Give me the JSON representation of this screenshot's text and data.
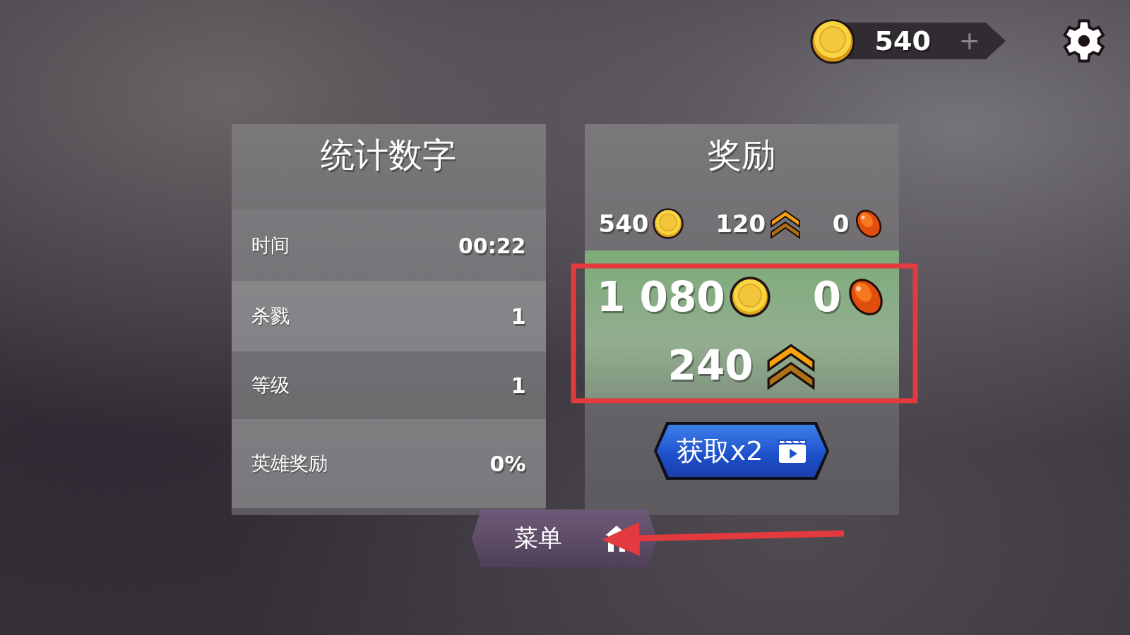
{
  "balance": {
    "amount": "540",
    "plus": "+"
  },
  "stats": {
    "title": "统计数字",
    "rows": [
      {
        "label": "时间",
        "value": "00:22"
      },
      {
        "label": "杀戮",
        "value": "1"
      },
      {
        "label": "等级",
        "value": "1"
      },
      {
        "label": "英雄奖励",
        "value": "0%"
      }
    ]
  },
  "rewards": {
    "title": "奖励",
    "totals": [
      {
        "amount": "540",
        "kind": "coin"
      },
      {
        "amount": "120",
        "kind": "rank"
      },
      {
        "amount": "0",
        "kind": "gem"
      }
    ],
    "doubled": [
      {
        "amount": "1 080",
        "kind": "coin"
      },
      {
        "amount": "0",
        "kind": "gem"
      },
      {
        "amount": "240",
        "kind": "rank"
      }
    ]
  },
  "double_button": {
    "label": "获取x2"
  },
  "menu_button": {
    "label": "菜单"
  }
}
